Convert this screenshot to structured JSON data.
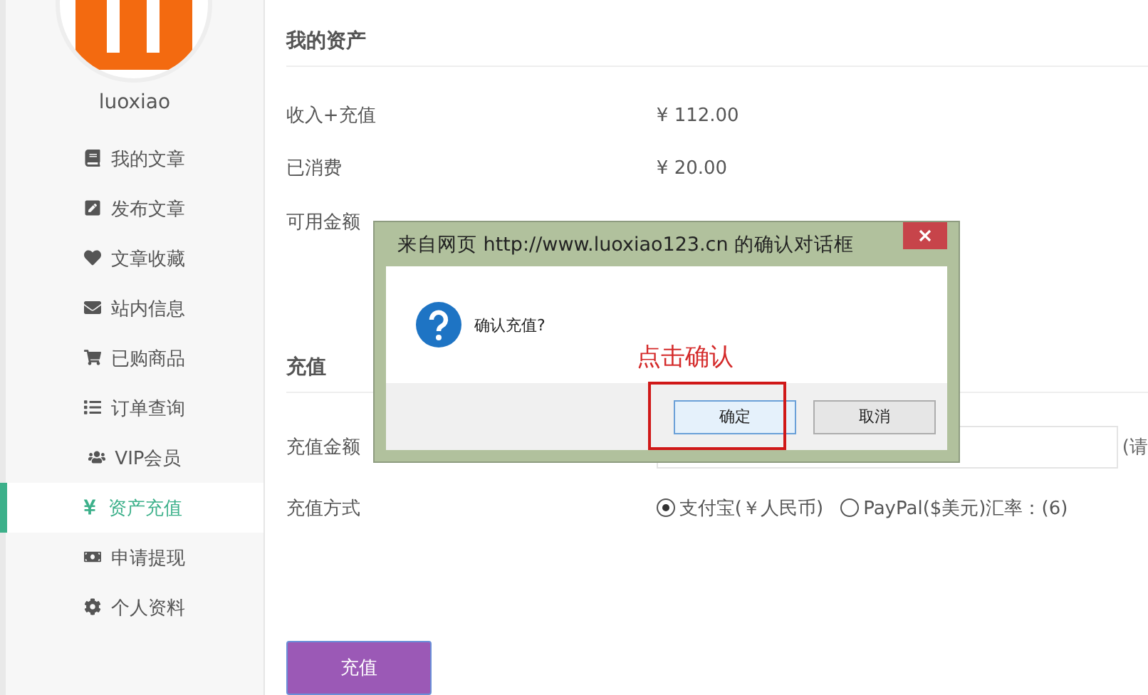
{
  "sidebar": {
    "username": "luoxiao",
    "items": [
      {
        "label": "我的文章",
        "selected": false
      },
      {
        "label": "发布文章",
        "selected": false
      },
      {
        "label": "文章收藏",
        "selected": false
      },
      {
        "label": "站内信息",
        "selected": false
      },
      {
        "label": "已购商品",
        "selected": false
      },
      {
        "label": "订单查询",
        "selected": false
      },
      {
        "label": "VIP会员",
        "selected": false
      },
      {
        "label": "资产充值",
        "selected": true
      },
      {
        "label": "申请提现",
        "selected": false
      },
      {
        "label": "个人资料",
        "selected": false
      }
    ]
  },
  "assets": {
    "title": "我的资产",
    "rows": [
      {
        "label": "收入+充值",
        "value": "¥ 112.00"
      },
      {
        "label": "已消费",
        "value": "¥ 20.00"
      },
      {
        "label": "可用金额"
      }
    ]
  },
  "recharge": {
    "title": "充值",
    "amount_label": "充值金额",
    "amount_hint": "(请",
    "method_label": "充值方式",
    "methods": [
      {
        "label": "支付宝(￥人民币)",
        "selected": true
      },
      {
        "label": "PayPal($美元)汇率：(6)",
        "selected": false
      }
    ],
    "submit": "充值"
  },
  "dialog": {
    "title": "来自网页 http://www.luoxiao123.cn 的确认对话框",
    "message": "确认充值?",
    "buttons": [
      "确定",
      "取消"
    ]
  },
  "annotation": {
    "text": "点击确认"
  }
}
